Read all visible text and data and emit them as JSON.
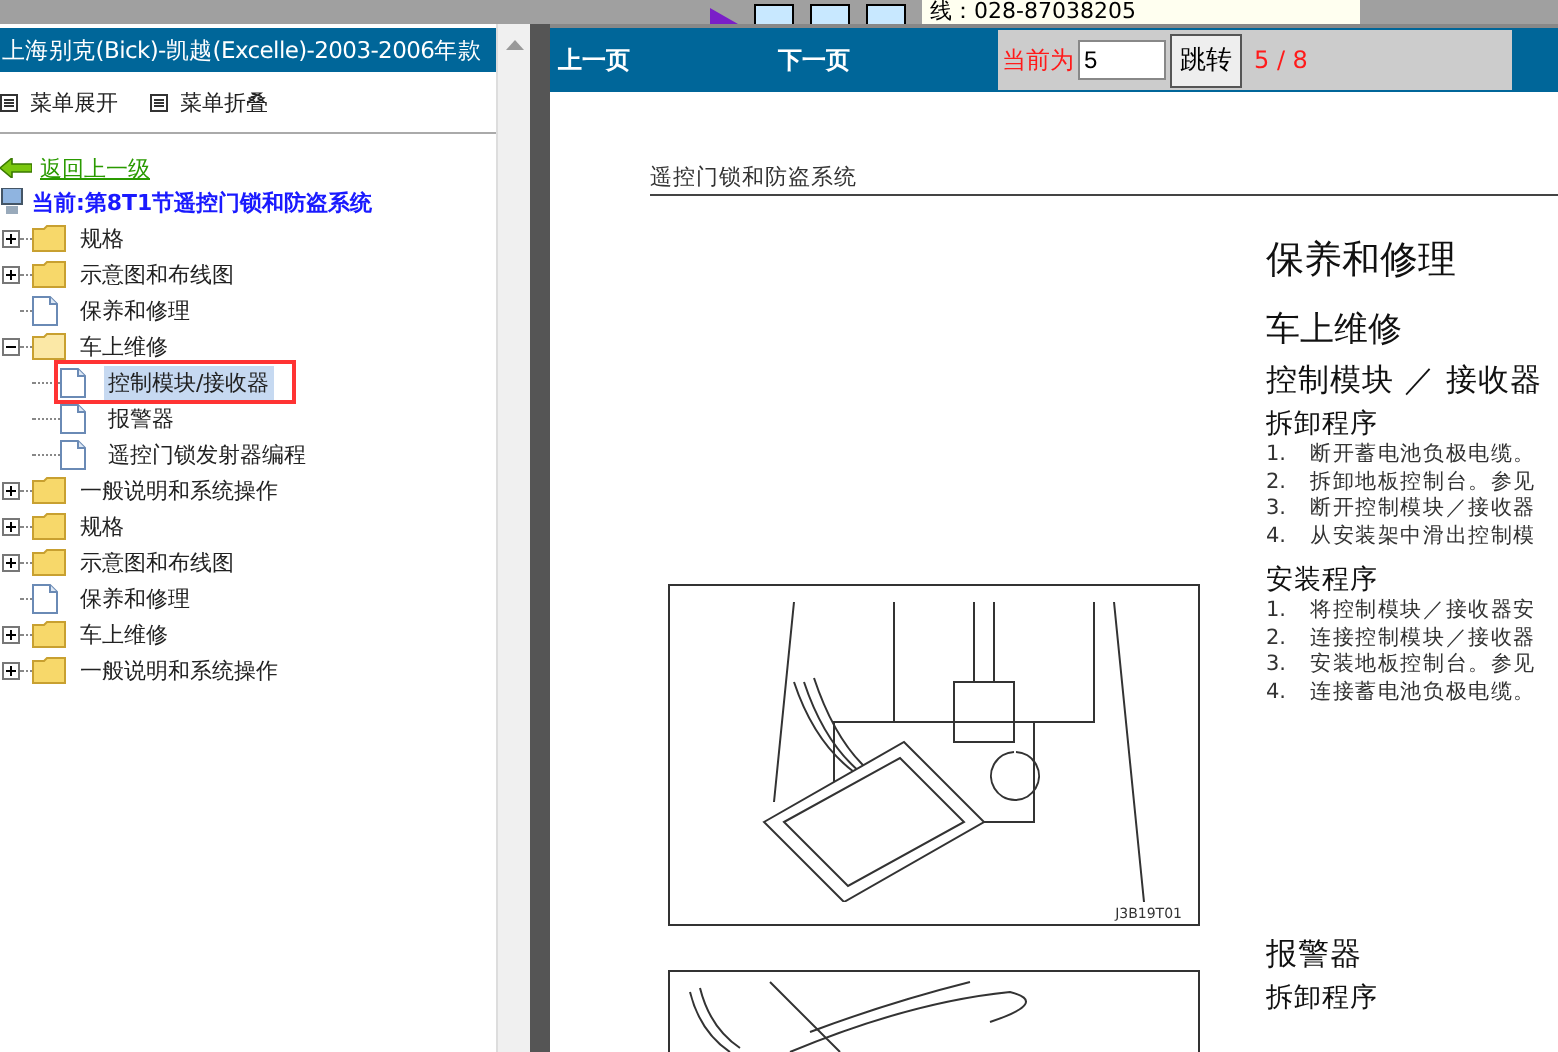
{
  "top_strip": {
    "phone_text": "线：028-87038205"
  },
  "left_pane": {
    "title": "上海别克(Bick)-凯越(Excelle)-2003-2006年款",
    "menu": [
      {
        "label": "菜单展开"
      },
      {
        "label": "菜单折叠"
      }
    ],
    "back_link": "返回上一级",
    "current": "当前:第8T1节遥控门锁和防盗系统",
    "tree": [
      {
        "label": "规格",
        "kind": "folder",
        "expanded": false,
        "selected": false
      },
      {
        "label": "示意图和布线图",
        "kind": "folder",
        "expanded": false,
        "selected": false
      },
      {
        "label": "保养和修理",
        "kind": "page",
        "selected": false
      },
      {
        "label": "车上维修",
        "kind": "folder",
        "expanded": true,
        "selected": false,
        "children": [
          {
            "label": "控制模块/接收器",
            "kind": "page",
            "selected": true,
            "annotated": true
          },
          {
            "label": "报警器",
            "kind": "page",
            "selected": false,
            "annotated": false
          },
          {
            "label": "遥控门锁发射器编程",
            "kind": "page",
            "selected": false,
            "annotated": false
          }
        ]
      },
      {
        "label": "一般说明和系统操作",
        "kind": "folder",
        "expanded": false,
        "selected": false
      },
      {
        "label": "规格",
        "kind": "folder",
        "expanded": false,
        "selected": false
      },
      {
        "label": "示意图和布线图",
        "kind": "folder",
        "expanded": false,
        "selected": false
      },
      {
        "label": "保养和修理",
        "kind": "page",
        "selected": false
      },
      {
        "label": "车上维修",
        "kind": "folder",
        "expanded": false,
        "selected": false
      },
      {
        "label": "一般说明和系统操作",
        "kind": "folder",
        "expanded": false,
        "selected": false
      }
    ]
  },
  "toolbar": {
    "prev": "上一页",
    "next": "下一页",
    "current_label": "当前为",
    "page_value": "5",
    "go_button": "跳转",
    "page_count": "5 / 8"
  },
  "document": {
    "running_head": "遥控门锁和防盗系统",
    "figure_code": "J3B19T01",
    "section_title": "保养和修理",
    "subsection_title": "车上维修",
    "component_title": "控制模块 ／ 接收器",
    "procedures": [
      {
        "title": "拆卸程序",
        "steps": [
          {
            "number": "1.",
            "text": "断开蓄电池负极电缆。"
          },
          {
            "number": "2.",
            "text": "拆卸地板控制台。参见"
          },
          {
            "number": "3.",
            "text": "断开控制模块／接收器"
          },
          {
            "number": "4.",
            "text": "从安装架中滑出控制模"
          }
        ]
      },
      {
        "title": "安装程序",
        "steps": [
          {
            "number": "1.",
            "text": "将控制模块／接收器安"
          },
          {
            "number": "2.",
            "text": "连接控制模块／接收器"
          },
          {
            "number": "3.",
            "text": "安装地板控制台。参见"
          },
          {
            "number": "4.",
            "text": "连接蓄电池负极电缆。"
          }
        ]
      }
    ],
    "next_component_title": "报警器",
    "next_procedure_title": "拆卸程序"
  }
}
